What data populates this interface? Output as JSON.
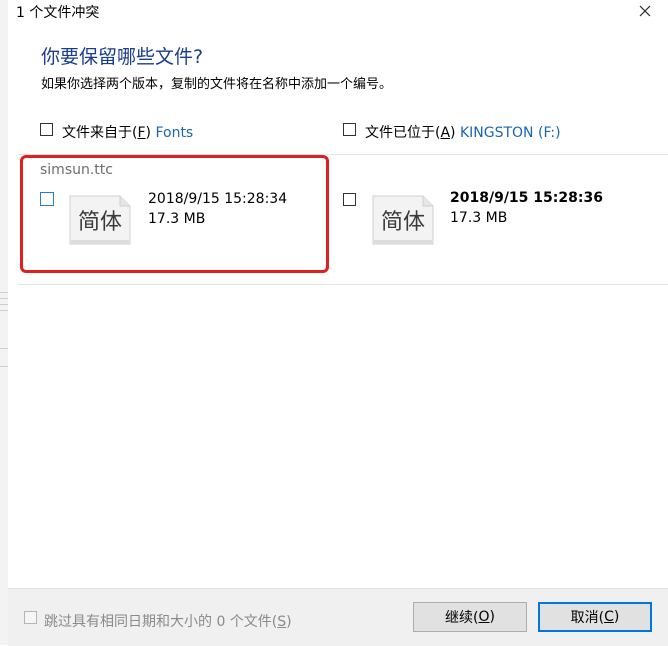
{
  "window": {
    "title": "1 个文件冲突",
    "heading": "你要保留哪些文件?",
    "subheading": "如果你选择两个版本，复制的文件将在名称中添加一个编号。"
  },
  "source": {
    "label_prefix": "文件来自于(",
    "hotkey": "F",
    "label_suffix": ")",
    "location": "Fonts"
  },
  "destination": {
    "label_prefix": "文件已位于(",
    "hotkey": "A",
    "label_suffix": ")",
    "location": "KINGSTON (F:)"
  },
  "conflict": {
    "filename": "simsun.ttc",
    "source_file": {
      "date": "2018/9/15 15:28:34",
      "size": "17.3 MB",
      "icon_glyph": "简体"
    },
    "dest_file": {
      "date": "2018/9/15 15:28:36",
      "size": "17.3 MB",
      "icon_glyph": "简体"
    }
  },
  "footer": {
    "skip_prefix": "跳过具有相同日期和大小的 0 个文件(",
    "skip_hotkey": "S",
    "skip_suffix": ")",
    "continue_prefix": "继续(",
    "continue_hotkey": "O",
    "continue_suffix": ")",
    "cancel_prefix": "取消(",
    "cancel_hotkey": "C",
    "cancel_suffix": ")"
  },
  "colors": {
    "heading": "#1a3d8f",
    "accent_link": "#1a66b3",
    "highlight_box": "#e02020",
    "default_button_border": "#0078d7"
  }
}
